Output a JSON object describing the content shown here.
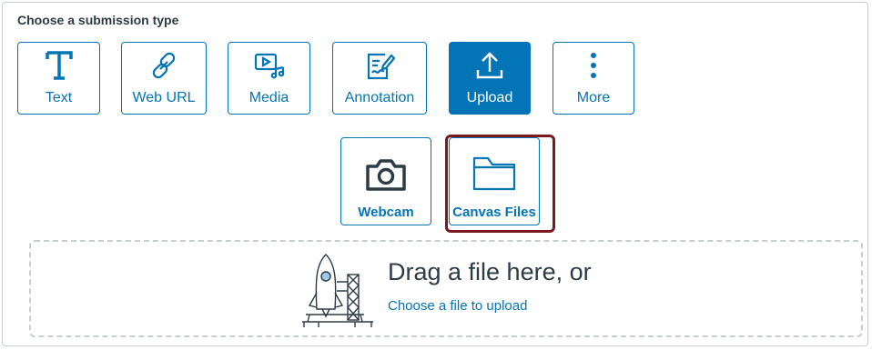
{
  "heading": "Choose a submission type",
  "submission_types": [
    {
      "label": "Text",
      "icon": "text-icon",
      "active": false
    },
    {
      "label": "Web URL",
      "icon": "link-icon",
      "active": false
    },
    {
      "label": "Media",
      "icon": "media-icon",
      "active": false
    },
    {
      "label": "Annotation",
      "icon": "annotation-icon",
      "active": false
    },
    {
      "label": "Upload",
      "icon": "upload-icon",
      "active": true
    },
    {
      "label": "More",
      "icon": "more-vertical-icon",
      "active": false
    }
  ],
  "upload_options": [
    {
      "label": "Webcam",
      "icon": "camera-icon"
    },
    {
      "label": "Canvas Files",
      "icon": "folder-icon",
      "highlighted": true
    }
  ],
  "dropzone": {
    "title": "Drag a file here, or",
    "link": "Choose a file to upload",
    "illustration": "rocket-launch-icon"
  },
  "colors": {
    "accent": "#0374b5",
    "text": "#2d3b45",
    "border": "#c7cdd1",
    "highlight": "#7a1a1f"
  }
}
